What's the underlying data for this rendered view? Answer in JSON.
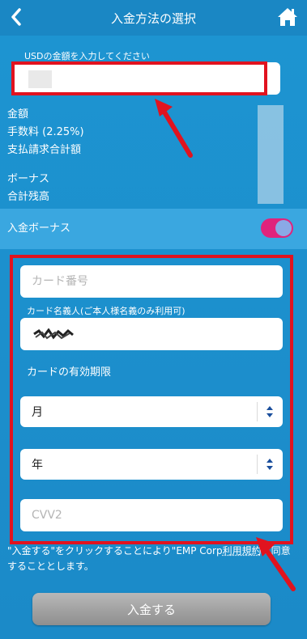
{
  "header": {
    "title": "入金方法の選択",
    "back_icon": "chevron-left-icon",
    "home_icon": "home-icon"
  },
  "amount": {
    "label": "USDの金額を入力してください",
    "value": ""
  },
  "summary": {
    "amount_label": "金額",
    "fee_label": "手数料 (2.25%)",
    "total_label": "支払請求合計額",
    "bonus_label": "ボーナス",
    "balance_label": "合計残高"
  },
  "deposit_bonus": {
    "label": "入金ボーナス",
    "enabled": true,
    "toggle_color": "#e0237c"
  },
  "card": {
    "number_placeholder": "カード番号",
    "holder_label": "カード名義人(ご本人様名義のみ利用可)",
    "expiry_label": "カードの有効期限",
    "month_value": "月",
    "year_value": "年",
    "cvv_placeholder": "CVV2"
  },
  "notice": {
    "text_before": "\"入金する\"をクリックすることにより\"EMP Corp",
    "link_text": "利用規約",
    "text_after": "に同意することとします。"
  },
  "submit_label": "入金する",
  "colors": {
    "background": "#1b8fcc",
    "highlight_red": "#e1131f"
  }
}
